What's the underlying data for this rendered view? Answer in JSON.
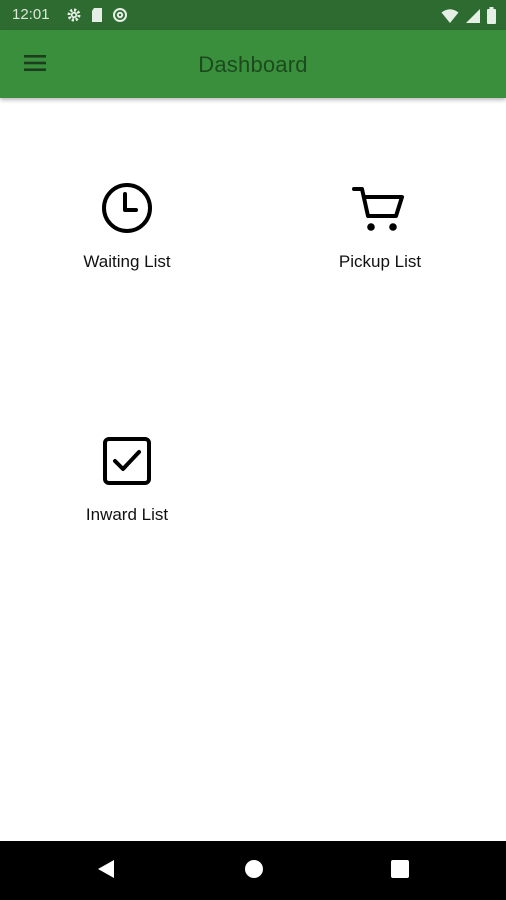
{
  "status_bar": {
    "time": "12:01",
    "left_icons": [
      "gear-icon",
      "sd-card-icon",
      "at-sign-icon"
    ],
    "right_icons": [
      "wifi-icon",
      "cell-signal-icon",
      "battery-icon"
    ]
  },
  "app_bar": {
    "title": "Dashboard",
    "menu_icon": "hamburger-menu-icon",
    "color": "#3a8f3d"
  },
  "tiles": [
    {
      "label": "Waiting List",
      "icon": "clock-icon"
    },
    {
      "label": "Pickup List",
      "icon": "shopping-cart-icon"
    },
    {
      "label": "Inward List",
      "icon": "checkbox-checked-icon"
    }
  ],
  "nav_bar": {
    "buttons": [
      "back-triangle-icon",
      "home-circle-icon",
      "recents-square-icon"
    ]
  }
}
